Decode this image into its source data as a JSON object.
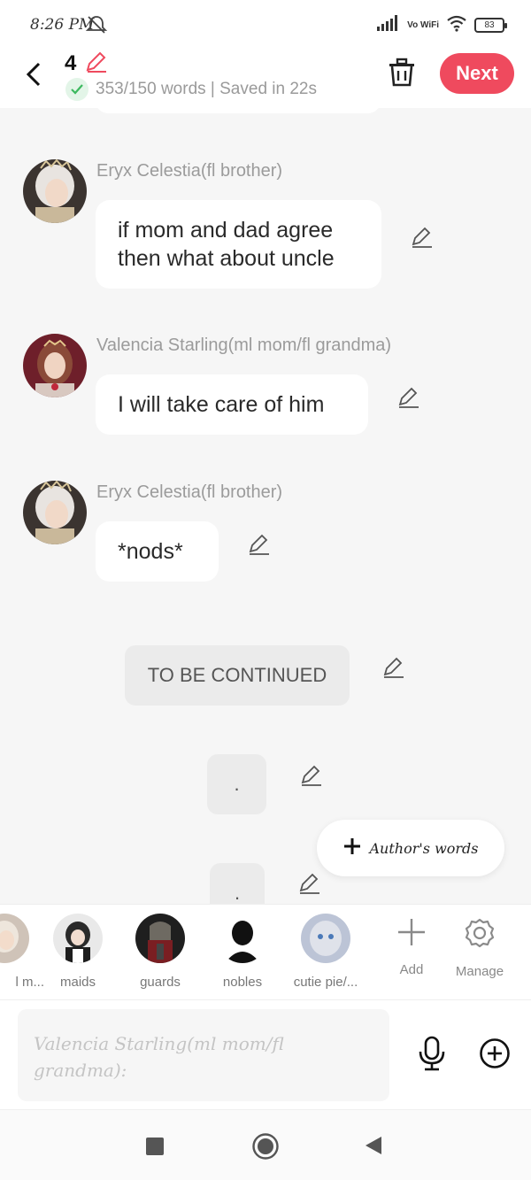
{
  "status_bar": {
    "time": "8:26 PM",
    "network_label": "Vo WiFi",
    "battery": "83"
  },
  "header": {
    "chapter_number": "4",
    "saved_status": "353/150 words | Saved in 22s",
    "next_label": "Next"
  },
  "messages": [
    {
      "sender": "Eryx Celestia(fl brother)",
      "text_line1": "if mom and dad agree",
      "text_line2": "then what about uncle"
    },
    {
      "sender": "Valencia Starling(ml mom/fl grandma)",
      "text": "I will take care of him"
    },
    {
      "sender": "Eryx Celestia(fl brother)",
      "text": "*nods*"
    }
  ],
  "narration": {
    "to_be_continued": "TO BE CONTINUED",
    "dot1": ".",
    "dot2": "."
  },
  "authors_words": {
    "label": "Author's words"
  },
  "characters": [
    {
      "name": "l m..."
    },
    {
      "name": "maids"
    },
    {
      "name": "guards"
    },
    {
      "name": "nobles"
    },
    {
      "name": "cutie pie/..."
    }
  ],
  "tools": {
    "add_label": "Add",
    "manage_label": "Manage"
  },
  "input": {
    "placeholder": "Valencia Starling(ml mom/fl grandma):"
  },
  "colors": {
    "accent": "#ef4a5e",
    "check_green": "#3cb95f",
    "background": "#f6f6f6"
  }
}
